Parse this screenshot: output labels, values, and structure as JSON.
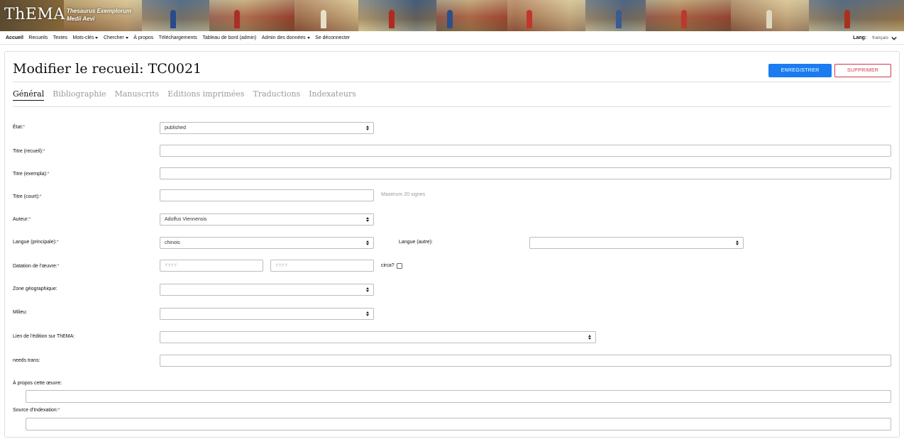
{
  "brand": {
    "name": "ThEMA",
    "subtitle_line1": "Thesaurus Exemplorum",
    "subtitle_line2": "Medii Aevi"
  },
  "nav": {
    "items": [
      {
        "label": "Accueil",
        "active": true
      },
      {
        "label": "Recueils"
      },
      {
        "label": "Textes"
      },
      {
        "label": "Mots-clés",
        "dropdown": true
      },
      {
        "label": "Chercher",
        "dropdown": true
      },
      {
        "label": "À propos"
      },
      {
        "label": "Téléchargements"
      },
      {
        "label": "Tableau de bord (admin)"
      },
      {
        "label": "Admin des données",
        "dropdown": true
      },
      {
        "label": "Se déconnecter"
      }
    ],
    "lang_label": "Lang:",
    "lang_value": "français"
  },
  "page": {
    "title": "Modifier le recueil: TC0021",
    "save_label": "ENREGISTRER",
    "delete_label": "SUPPRIMER"
  },
  "tabs": [
    "Général",
    "Bibliographie",
    "Manuscrits",
    "Editions imprimées",
    "Traductions",
    "Indexateurs"
  ],
  "form": {
    "etat_label": "État:",
    "etat_value": "published",
    "titre_recueil_label": "Titre (recueil):",
    "titre_exempla_label": "Titre (exempla):",
    "titre_court_label": "Titre (court):",
    "titre_court_hint": "Maximum 20 signes",
    "auteur_label": "Auteur:",
    "auteur_value": "Adolfus Viennensis",
    "langue_principale_label": "Langue (principale):",
    "langue_principale_value": "chinois",
    "langue_autre_label": "Langue (autre):",
    "datation_label": "Datation de l'œuvre:",
    "datation_from_placeholder": "YYYY",
    "datation_to_placeholder": "YYYY",
    "circa_label": "circa?",
    "zone_label": "Zone géographique:",
    "milieu_label": "Milieu:",
    "lien_label": "Lien de l'édition sur ThEMA:",
    "needs_trans_label": "needs trans:",
    "apropos_label": "À propos cette œuvre:",
    "source_label": "Source d'Indexation:",
    "required_mark": "*"
  },
  "colors": {
    "primary": "#1a7cf0",
    "danger": "#d0384a"
  }
}
